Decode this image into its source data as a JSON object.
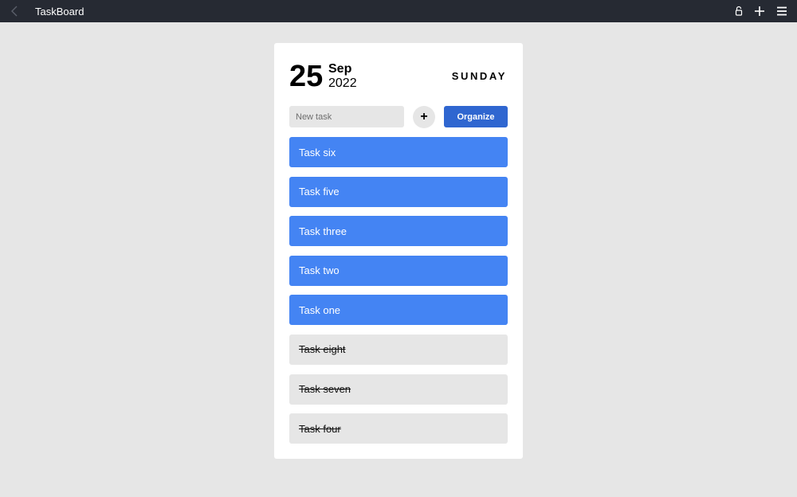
{
  "app": {
    "title": "TaskBoard",
    "icons": {
      "back": "chevron-left-icon",
      "lock": "lock-icon",
      "add": "plus-icon",
      "menu": "hamburger-menu-icon"
    }
  },
  "date": {
    "day": "25",
    "month": "Sep",
    "year": "2022",
    "weekday": "SUNDAY"
  },
  "new_task": {
    "placeholder": "New task",
    "value": "",
    "add_label": "+",
    "organize_label": "Organize"
  },
  "tasks": [
    {
      "label": "Task six",
      "done": false
    },
    {
      "label": "Task five",
      "done": false
    },
    {
      "label": "Task three",
      "done": false
    },
    {
      "label": "Task two",
      "done": false
    },
    {
      "label": "Task one",
      "done": false
    },
    {
      "label": "Task eight",
      "done": true
    },
    {
      "label": "Task seven",
      "done": true
    },
    {
      "label": "Task four",
      "done": true
    }
  ],
  "colors": {
    "titlebar": "#262a33",
    "active_task": "#4484f3",
    "done_task": "#e6e6e6",
    "organize_button": "#2f66d0",
    "background": "#e6e6e6"
  }
}
